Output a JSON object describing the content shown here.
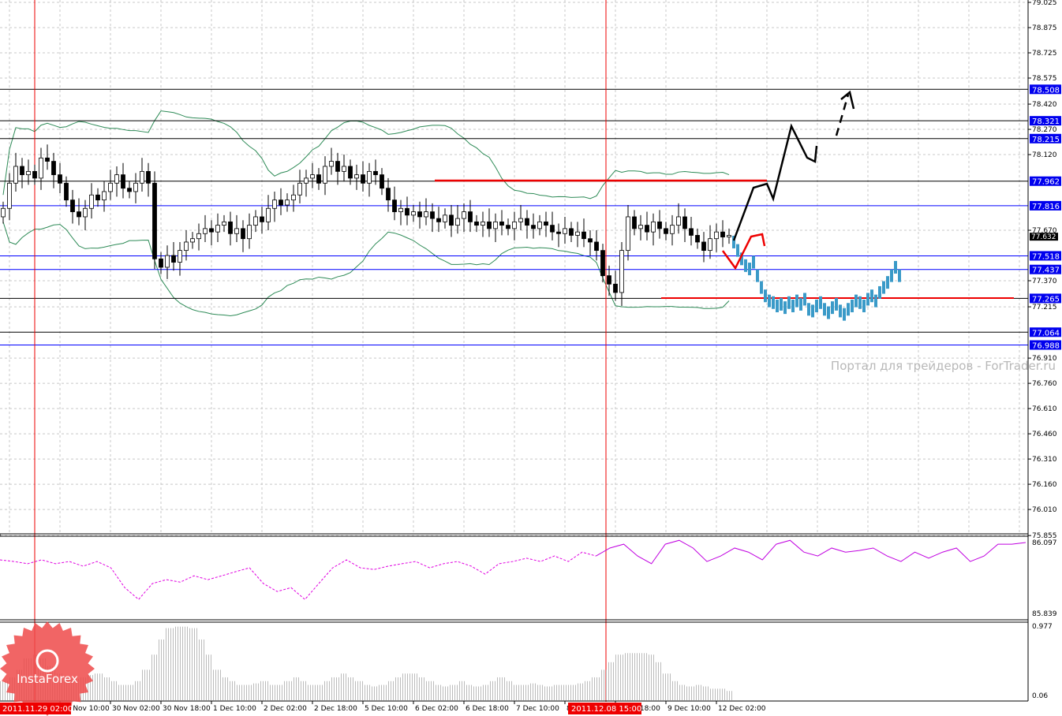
{
  "chart_data": {
    "type": "candlestick",
    "symbol_pane": {
      "price_ticks": [
        "79.025",
        "78.875",
        "78.725",
        "78.575",
        "78.420",
        "78.270",
        "78.120",
        "77.670",
        "77.370",
        "77.215",
        "76.910",
        "76.760",
        "76.610",
        "76.460",
        "76.310",
        "76.160",
        "76.010",
        "75.855"
      ],
      "price_range": [
        75.855,
        79.025
      ],
      "closes": [
        77.8,
        77.95,
        78.05,
        78.0,
        78.02,
        77.98,
        78.1,
        78.08,
        78.0,
        77.95,
        77.85,
        77.78,
        77.75,
        77.8,
        77.88,
        77.85,
        77.9,
        77.95,
        78.0,
        77.92,
        77.9,
        77.95,
        78.02,
        77.95,
        77.5,
        77.45,
        77.52,
        77.48,
        77.55,
        77.6,
        77.62,
        77.65,
        77.68,
        77.66,
        77.7,
        77.72,
        77.65,
        77.68,
        77.62,
        77.7,
        77.75,
        77.72,
        77.8,
        77.85,
        77.82,
        77.85,
        77.88,
        77.95,
        77.98,
        78.0,
        77.95,
        78.05,
        78.08,
        78.02,
        78.05,
        77.98,
        78.0,
        77.95,
        78.02,
        78.0,
        77.92,
        77.85,
        77.78,
        77.8,
        77.76,
        77.78,
        77.75,
        77.78,
        77.74,
        77.72,
        77.76,
        77.7,
        77.74,
        77.78,
        77.72,
        77.7,
        77.72,
        77.68,
        77.72,
        77.7,
        77.68,
        77.72,
        77.74,
        77.7,
        77.68,
        77.72,
        77.7,
        77.66,
        77.65,
        77.68,
        77.64,
        77.66,
        77.62,
        77.6,
        77.55,
        77.4,
        77.35,
        77.3,
        77.55,
        77.75,
        77.68,
        77.7,
        77.66,
        77.72,
        77.68,
        77.65,
        77.7,
        77.75,
        77.68,
        77.64,
        77.6,
        77.55,
        77.62,
        77.66,
        77.63,
        77.64
      ],
      "current_price": "77.632",
      "levels": [
        {
          "price": "78.508",
          "color": "#000000"
        },
        {
          "price": "78.321",
          "color": "#000000"
        },
        {
          "price": "78.215",
          "color": "#000000"
        },
        {
          "price": "77.962",
          "color": "#000000"
        },
        {
          "price": "77.816",
          "color": "#0000ff"
        },
        {
          "price": "77.518",
          "color": "#0000ff"
        },
        {
          "price": "77.437",
          "color": "#0000ff"
        },
        {
          "price": "77.265",
          "color": "#000000"
        },
        {
          "price": "77.064",
          "color": "#000000"
        },
        {
          "price": "76.988",
          "color": "#0000ff"
        }
      ],
      "forecast": [
        77.6,
        77.55,
        77.5,
        77.46,
        77.44,
        77.48,
        77.4,
        77.33,
        77.28,
        77.25,
        77.24,
        77.22,
        77.23,
        77.21,
        77.24,
        77.22,
        77.25,
        77.23,
        77.26,
        77.2,
        77.19,
        77.22,
        77.24,
        77.2,
        77.18,
        77.21,
        77.23,
        77.19,
        77.17,
        77.2,
        77.22,
        77.25,
        77.24,
        77.22,
        77.26,
        77.28,
        77.25,
        77.3,
        77.33,
        77.36,
        77.4,
        77.45,
        77.4
      ],
      "watermark": "Портал для трейдеров - ForTrader.ru"
    },
    "indicator1": {
      "labels": [
        "86.097",
        "85.839"
      ],
      "range": [
        85.839,
        86.097
      ],
      "values": [
        86.034,
        86.028,
        86.02,
        86.034,
        86.02,
        86.028,
        86.011,
        86.028,
        86.005,
        85.933,
        85.89,
        85.948,
        85.962,
        85.953,
        85.976,
        85.962,
        85.976,
        85.991,
        86.005,
        85.948,
        85.919,
        85.933,
        85.89,
        85.948,
        86.005,
        86.034,
        86.005,
        85.999,
        86.011,
        86.02,
        86.028,
        86.005,
        86.02,
        86.028,
        86.011,
        85.982,
        86.02,
        86.028,
        86.04,
        86.028,
        86.048,
        86.028,
        86.062,
        86.048,
        86.077,
        86.091,
        86.048,
        86.02,
        86.091,
        86.105,
        86.077,
        86.028,
        86.048,
        86.077,
        86.062,
        86.034,
        86.091,
        86.105,
        86.062,
        86.048,
        86.077,
        86.062,
        86.068,
        86.077,
        86.048,
        86.028,
        86.062,
        86.04,
        86.062,
        86.077,
        86.028,
        86.048,
        86.091,
        86.091,
        86.097
      ],
      "dashed_until_index": 43
    },
    "indicator2": {
      "labels": [
        "0.977",
        "0.06"
      ],
      "range": [
        0.06,
        0.977
      ],
      "values": [
        0.25,
        0.3,
        0.4,
        0.55,
        0.6,
        0.55,
        0.45,
        0.35,
        0.3,
        0.28,
        0.3,
        0.33,
        0.35,
        0.3,
        0.25,
        0.2,
        0.2,
        0.25,
        0.4,
        0.6,
        0.8,
        0.95,
        0.97,
        0.97,
        0.95,
        0.8,
        0.6,
        0.4,
        0.3,
        0.25,
        0.2,
        0.2,
        0.22,
        0.25,
        0.2,
        0.2,
        0.25,
        0.3,
        0.25,
        0.2,
        0.2,
        0.25,
        0.3,
        0.35,
        0.3,
        0.25,
        0.2,
        0.18,
        0.2,
        0.25,
        0.3,
        0.35,
        0.35,
        0.3,
        0.25,
        0.2,
        0.18,
        0.2,
        0.25,
        0.2,
        0.18,
        0.2,
        0.25,
        0.3,
        0.25,
        0.2,
        0.2,
        0.22,
        0.2,
        0.18,
        0.2,
        0.2,
        0.2,
        0.22,
        0.25,
        0.3,
        0.4,
        0.5,
        0.6,
        0.62,
        0.62,
        0.62,
        0.6,
        0.5,
        0.35,
        0.25,
        0.2,
        0.18,
        0.2,
        0.18,
        0.15,
        0.15,
        0.12
      ]
    },
    "time_labels": [
      "29 Nov 10:00",
      "30 Nov 02:00",
      "30 Nov 18:00",
      "1 Dec 10:00",
      "2 Dec 02:00",
      "2 Dec 18:00",
      "5 Dec 10:00",
      "6 Dec 02:00",
      "6 Dec 18:00",
      "7 Dec 10:00",
      "8 Dec 02:00",
      "8 Dec 18:00",
      "9 Dec 10:00",
      "12 Dec 02:00"
    ],
    "markers": [
      "2011.11.29 02:00",
      "2011.12.08 15:00"
    ],
    "logo": "InstaForex"
  }
}
